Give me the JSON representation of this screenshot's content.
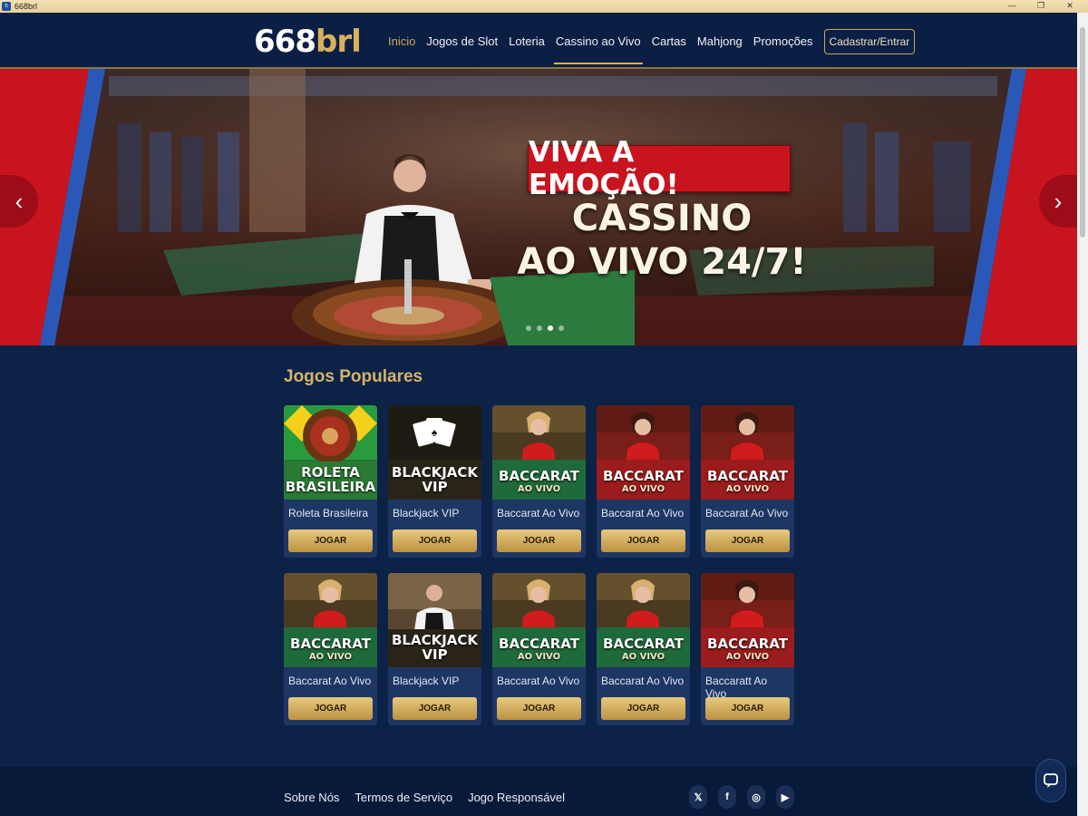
{
  "window": {
    "title": "668brl",
    "controls": [
      "—",
      "❐",
      "✕"
    ]
  },
  "header": {
    "logo_num": "668",
    "logo_brl": "brl",
    "nav": [
      {
        "label": "Inicio",
        "state": "home"
      },
      {
        "label": "Jogos de Slot",
        "state": ""
      },
      {
        "label": "Loteria",
        "state": ""
      },
      {
        "label": "Cassino ao Vivo",
        "state": "active"
      },
      {
        "label": "Cartas",
        "state": ""
      },
      {
        "label": "Mahjong",
        "state": ""
      },
      {
        "label": "Promoções",
        "state": ""
      }
    ],
    "auth_label": "Cadastrar/Entrar"
  },
  "banner": {
    "headline": "VIVA A EMOÇÃO!",
    "line1": "CASSINO",
    "line2": "AO VIVO 24/7!",
    "slide_count": 4,
    "active_slide": 2,
    "prev_icon": "chevron-left-icon",
    "next_icon": "chevron-right-icon"
  },
  "section": {
    "title": "Jogos Populares"
  },
  "games": [
    {
      "name": "Roleta Brasileira",
      "cap1": "ROLETA",
      "cap2": "BRASILEIRA",
      "kind": "roulette",
      "play": "JOGAR"
    },
    {
      "name": "Blackjack VIP",
      "cap1": "BLACKJACK",
      "cap2": "VIP",
      "kind": "cards",
      "play": "JOGAR"
    },
    {
      "name": "Baccarat Ao Vivo",
      "cap1": "BACCARAT",
      "cap2": "AO VIVO",
      "kind": "green",
      "play": "JOGAR"
    },
    {
      "name": "Baccarat Ao Vivo",
      "cap1": "BACCARAT",
      "cap2": "AO VIVO",
      "kind": "red",
      "play": "JOGAR"
    },
    {
      "name": "Baccarat Ao Vivo",
      "cap1": "BACCARAT",
      "cap2": "AO VIVO",
      "kind": "red",
      "play": "JOGAR"
    },
    {
      "name": "Baccarat Ao Vivo",
      "cap1": "BACCARAT",
      "cap2": "AO VIVO",
      "kind": "green",
      "play": "JOGAR"
    },
    {
      "name": "Blackjack VIP",
      "cap1": "BLACKJACK",
      "cap2": "VIP",
      "kind": "dealer",
      "play": "JOGAR"
    },
    {
      "name": "Baccarat Ao Vivo",
      "cap1": "BACCARAT",
      "cap2": "AO VIVO",
      "kind": "green",
      "play": "JOGAR"
    },
    {
      "name": "Baccarat Ao Vivo",
      "cap1": "BACCARAT",
      "cap2": "AO VIVO",
      "kind": "green",
      "play": "JOGAR"
    },
    {
      "name": "Baccaratt Ao Vivo",
      "cap1": "BACCARAT",
      "cap2": "AO VIVO",
      "kind": "red",
      "play": "JOGAR"
    }
  ],
  "footer": {
    "links": [
      "Sobre Nós",
      "Termos de Serviço",
      "Jogo Responsável"
    ],
    "social": [
      {
        "icon": "twitter-icon",
        "glyph": "𝕏"
      },
      {
        "icon": "facebook-icon",
        "glyph": "f"
      },
      {
        "icon": "instagram-icon",
        "glyph": "◎"
      },
      {
        "icon": "youtube-icon",
        "glyph": "▶"
      }
    ]
  },
  "colors": {
    "gold": "#d6b36a",
    "navy": "#0d2247",
    "red": "#c8141f",
    "button": "#d9b566"
  }
}
